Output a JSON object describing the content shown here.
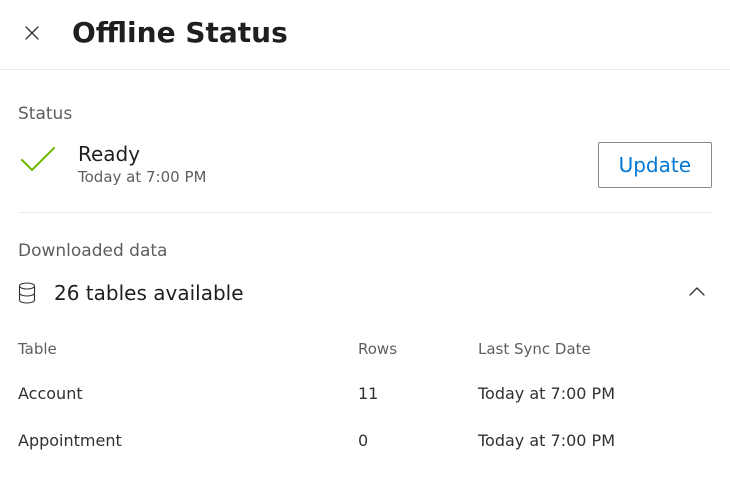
{
  "header": {
    "title": "Offline Status"
  },
  "status": {
    "section_label": "Status",
    "title": "Ready",
    "timestamp": "Today at 7:00 PM",
    "update_button": "Update"
  },
  "downloaded": {
    "section_label": "Downloaded data",
    "summary": "26 tables available",
    "columns": {
      "table": "Table",
      "rows": "Rows",
      "last_sync": "Last Sync Date"
    },
    "rows": [
      {
        "table": "Account",
        "rows": "11",
        "last_sync": "Today at 7:00 PM"
      },
      {
        "table": "Appointment",
        "rows": "0",
        "last_sync": "Today at 7:00 PM"
      }
    ]
  },
  "colors": {
    "accent": "#0078d4",
    "success": "#6bb700"
  }
}
